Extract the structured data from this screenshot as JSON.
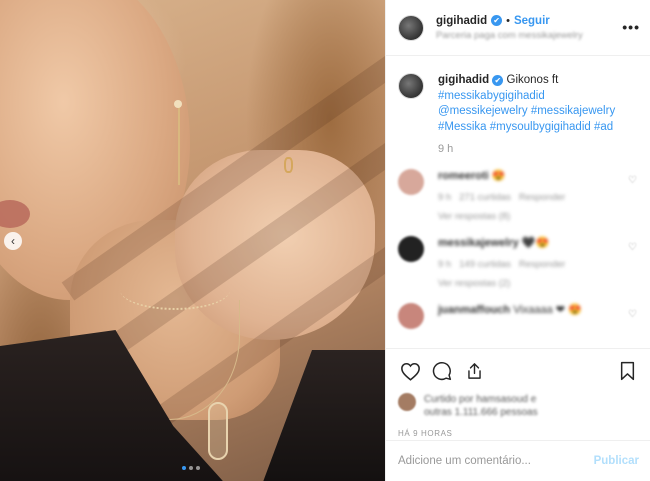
{
  "post": {
    "image_alt": "Close-up of woman wearing earrings, ring and necklaces",
    "carousel_prev": "‹",
    "carousel_dots": 3,
    "active_dot": 0
  },
  "header": {
    "username": "gigihadid",
    "verified_mark": "✔",
    "bullet": "•",
    "follow_label": "Seguir",
    "subtitle": "Parceria paga com messikajewelry",
    "more_label": "•••"
  },
  "caption": {
    "username": "gigihadid",
    "verified_mark": "✔",
    "text_intro": "Gikonos ft",
    "tags_line1": "#messikabygigihadid",
    "tags_line2": "@messikejewelry #messikajewelry",
    "tags_line3": "#Messika #mysoulbygigihadid #ad",
    "time": "9 h"
  },
  "comments": [
    {
      "user": "romeeroti",
      "text": "😍",
      "meta_time": "9 h",
      "meta_likes": "271 curtidas",
      "meta_reply": "Responder",
      "replies": "Ver respostas (8)",
      "avatar_color": "#d7a89b"
    },
    {
      "user": "messikajewelry",
      "text": "🖤😍",
      "meta_time": "9 h",
      "meta_likes": "149 curtidas",
      "meta_reply": "Responder",
      "replies": "Ver respostas (2)",
      "avatar_color": "#222222"
    },
    {
      "user": "juanmaffouch",
      "text": "Vixaaaa ❤ 😍",
      "meta_time": "",
      "meta_likes": "",
      "meta_reply": "",
      "replies": "",
      "avatar_color": "#c8867c"
    }
  ],
  "actions": {
    "like_icon": "heart-icon",
    "comment_icon": "comment-icon",
    "share_icon": "share-icon",
    "save_icon": "bookmark-icon"
  },
  "likes": {
    "line1": "Curtido por hamsasoud e",
    "line2": "outras 1.111.666 pessoas"
  },
  "timestamp": "HÁ 9 HORAS",
  "add_comment": {
    "placeholder": "Adicione um comentário...",
    "publish_label": "Publicar"
  },
  "colors": {
    "accent": "#3897f0",
    "publish_disabled": "#b2dffc",
    "border": "#efefef",
    "muted_text": "#999999"
  }
}
